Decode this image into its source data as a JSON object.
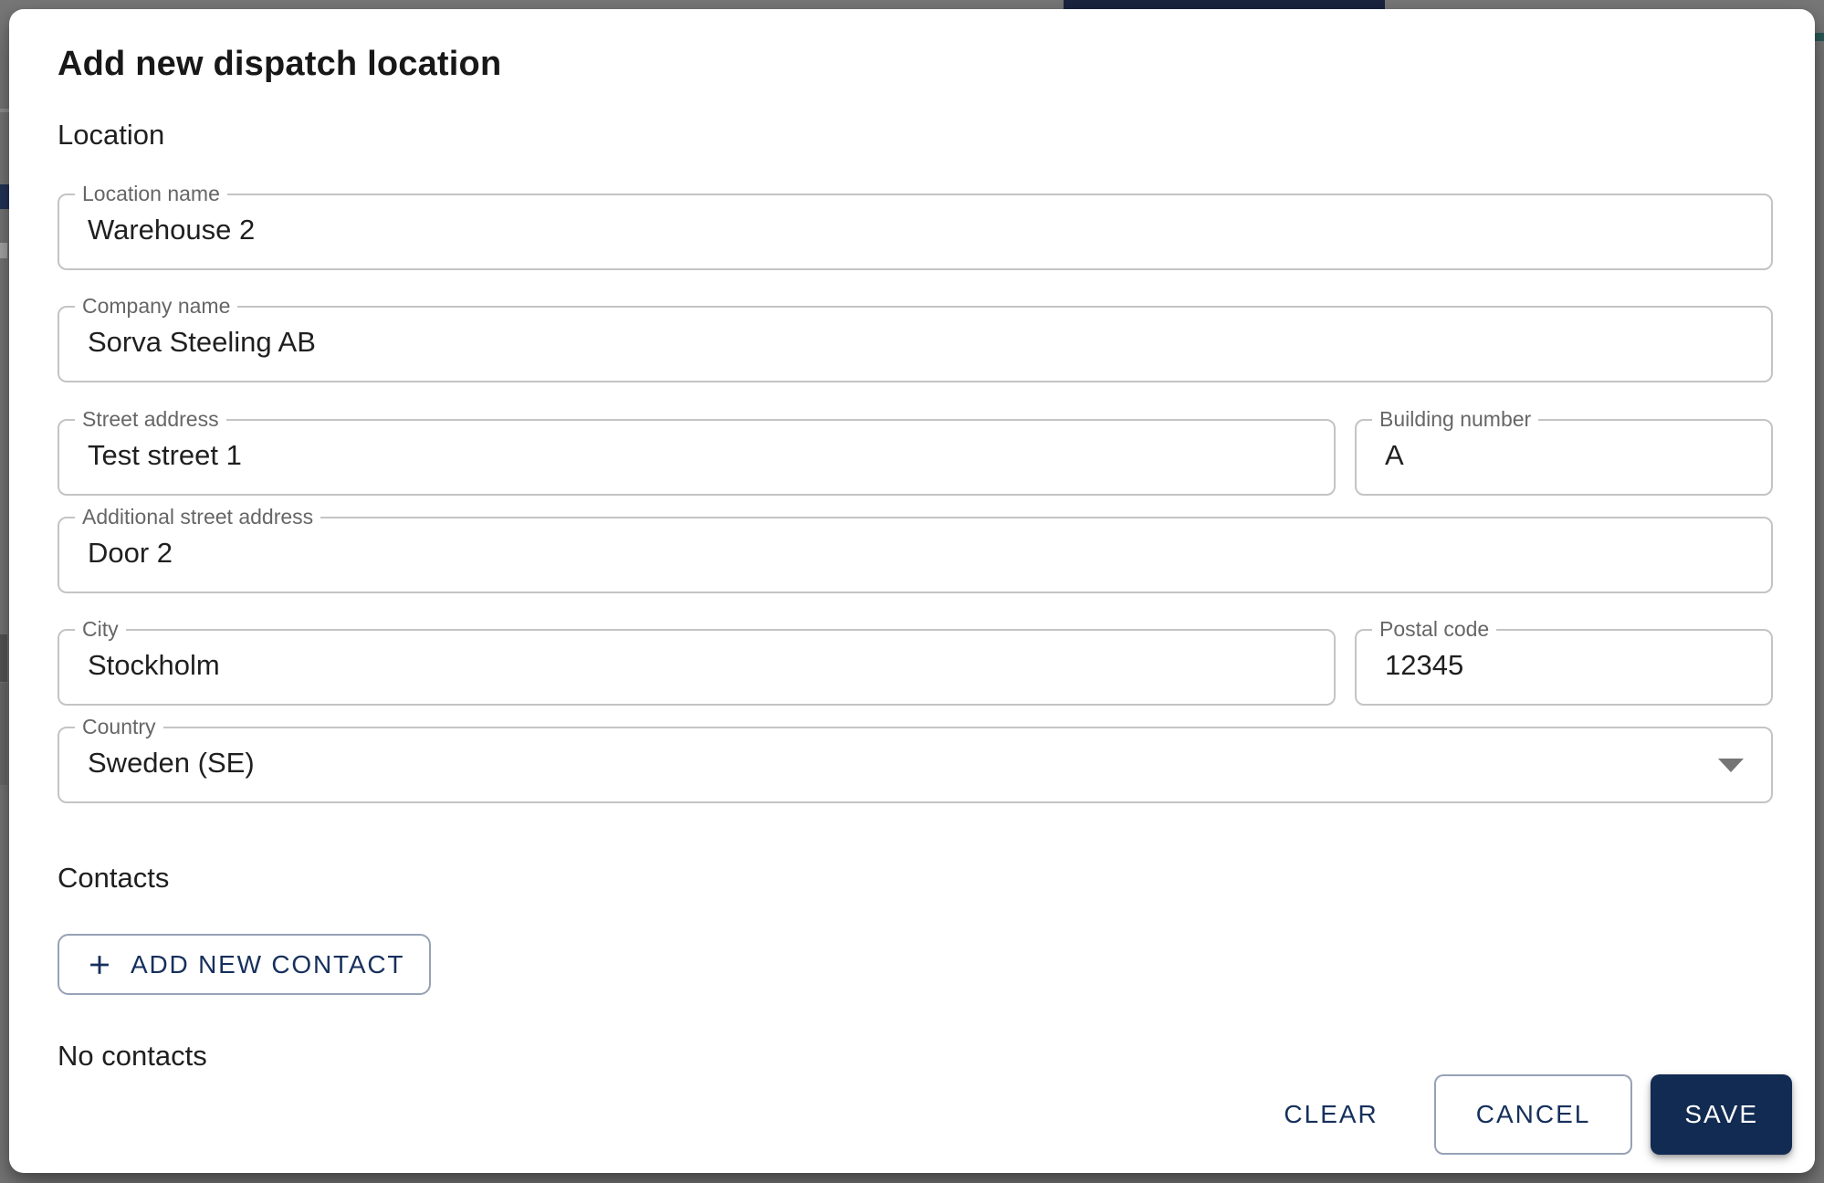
{
  "backdrop": {
    "overlay_color": "#777777",
    "remnant_colors": {
      "top_bar": "#1A2440",
      "teal_chip": "#2A5A58",
      "left_divider": "#929292",
      "left_navy_text": "#233459",
      "left_light_text": "#A9A9A9",
      "left_dark_block": "#565656",
      "left_mid_block": "#6B6B6B"
    }
  },
  "dialog": {
    "title": "Add new dispatch location",
    "location_section": {
      "heading": "Location",
      "fields": {
        "location_name": {
          "label": "Location name",
          "value": "Warehouse 2"
        },
        "company_name": {
          "label": "Company name",
          "value": "Sorva Steeling AB"
        },
        "street_address": {
          "label": "Street address",
          "value": "Test street 1"
        },
        "building_number": {
          "label": "Building number",
          "value": "A"
        },
        "additional_street_address": {
          "label": "Additional street address",
          "value": "Door 2"
        },
        "city": {
          "label": "City",
          "value": "Stockholm"
        },
        "postal_code": {
          "label": "Postal code",
          "value": "12345"
        },
        "country": {
          "label": "Country",
          "value": "Sweden (SE)"
        }
      }
    },
    "contacts_section": {
      "heading": "Contacts",
      "add_button_label": "ADD NEW CONTACT",
      "empty_state": "No contacts"
    },
    "actions": {
      "clear": "CLEAR",
      "cancel": "CANCEL",
      "save": "SAVE"
    },
    "icons": {
      "add_contact": "plus-icon",
      "country_dropdown": "caret-down-icon"
    },
    "colors": {
      "primary_navy": "#16305C",
      "save_button_bg": "#122B52",
      "save_button_text": "#FFFFFF",
      "field_border": "#C4C4C4",
      "field_label": "#666666",
      "field_value": "#1F1F1F",
      "dropdown_arrow": "#757575",
      "dialog_bg": "#FFFFFF"
    }
  }
}
